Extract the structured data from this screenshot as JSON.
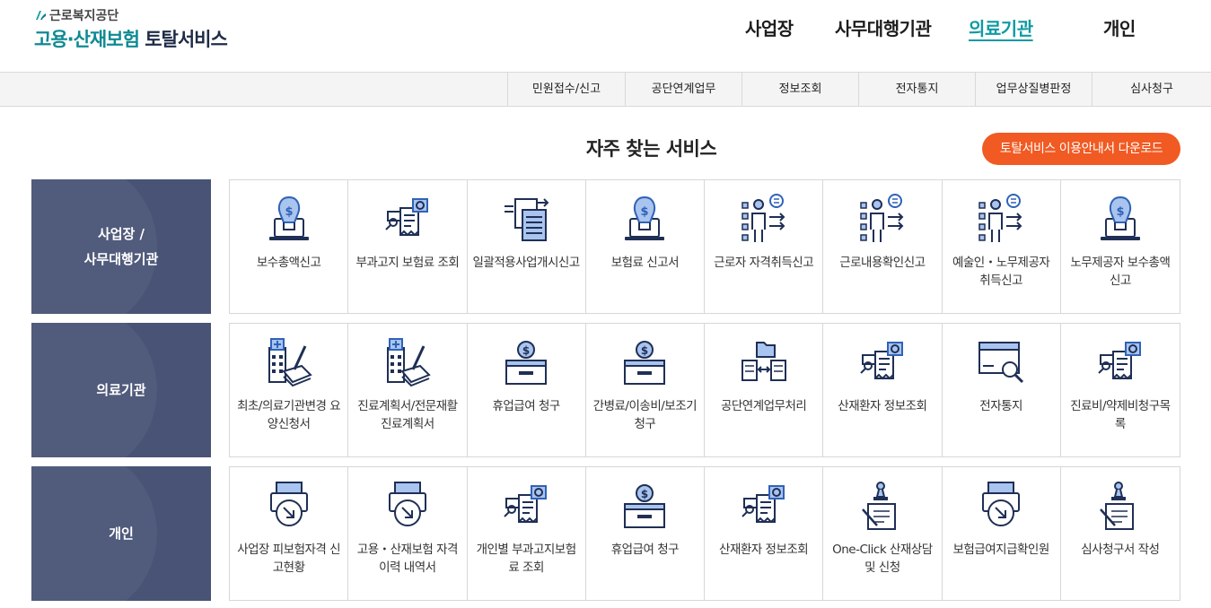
{
  "logo": {
    "org": "근로복지공단",
    "title_teal": "고용·산재보험",
    "title_dark": " 토탈서비스"
  },
  "gnb": [
    "사업장",
    "사무대행기관",
    "의료기관",
    "개인"
  ],
  "gnb_active": "의료기관",
  "subnav": [
    "민원접수/신고",
    "공단연계업무",
    "정보조회",
    "전자통지",
    "업무상질병판정",
    "심사청구"
  ],
  "section_title": "자주 찾는 서비스",
  "download_label": "토탈서비스 이용안내서 다운로드",
  "colors": {
    "accent": "#0f9aa3",
    "category_bg": "#485375",
    "button": "#f15a22",
    "icon_blue": "#2f63b8",
    "icon_light": "#a9c4ee"
  },
  "rows": [
    {
      "category": "사업장 /\n사무대행기관",
      "items": [
        {
          "label": "보수총액신고",
          "icon": "money-laptop-icon"
        },
        {
          "label": "부과고지 보험료 조회",
          "icon": "receipt-search-icon"
        },
        {
          "label": "일괄적용사업개시신고",
          "icon": "document-arrow-icon"
        },
        {
          "label": "보험료 신고서",
          "icon": "money-laptop-icon"
        },
        {
          "label": "근로자 자격취득신고",
          "icon": "worker-list-icon"
        },
        {
          "label": "근로내용확인신고",
          "icon": "worker-list-icon"
        },
        {
          "label": "예술인・노무제공자 취득신고",
          "icon": "worker-list-icon"
        },
        {
          "label": "노무제공자 보수총액신고",
          "icon": "money-laptop-icon"
        }
      ]
    },
    {
      "category": "의료기관",
      "items": [
        {
          "label": "최초/의료기관변경 요양신청서",
          "icon": "hospital-document-icon"
        },
        {
          "label": "진료계획서/전문재활진료계획서",
          "icon": "hospital-document-icon"
        },
        {
          "label": "휴업급여 청구",
          "icon": "money-box-icon"
        },
        {
          "label": "간병료/이송비/보조기 청구",
          "icon": "money-box-icon"
        },
        {
          "label": "공단연계업무처리",
          "icon": "folder-exchange-icon"
        },
        {
          "label": "산재환자 정보조회",
          "icon": "receipt-search-icon"
        },
        {
          "label": "전자통지",
          "icon": "mail-search-icon"
        },
        {
          "label": "진료비/약제비청구목록",
          "icon": "receipt-search-icon"
        }
      ]
    },
    {
      "category": "개인",
      "items": [
        {
          "label": "사업장 피보험자격 신고현황",
          "icon": "printer-download-icon"
        },
        {
          "label": "고용・산재보험 자격 이력 내역서",
          "icon": "printer-download-icon"
        },
        {
          "label": "개인별 부과고지보험료 조회",
          "icon": "receipt-search-icon"
        },
        {
          "label": "휴업급여 청구",
          "icon": "money-box-icon"
        },
        {
          "label": "산재환자 정보조회",
          "icon": "receipt-search-icon"
        },
        {
          "label": "One-Click 산재상담 및 신청",
          "icon": "stamp-document-icon"
        },
        {
          "label": "보험급여지급확인원",
          "icon": "printer-download-icon"
        },
        {
          "label": "심사청구서 작성",
          "icon": "stamp-document-icon"
        }
      ]
    }
  ]
}
